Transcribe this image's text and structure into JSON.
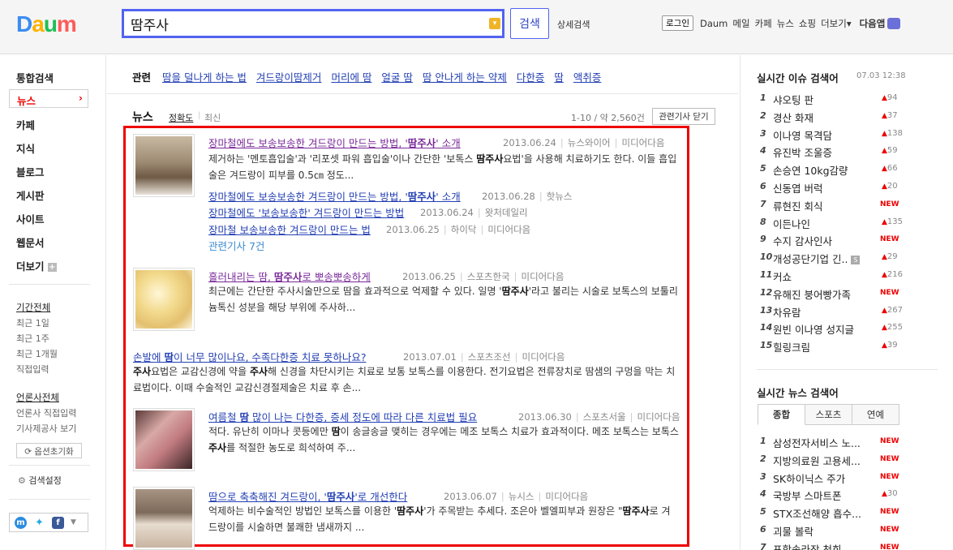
{
  "header": {
    "logo": [
      "D",
      "a",
      "u",
      "m"
    ],
    "logo_colors": [
      "#3c8cf0",
      "#ffb200",
      "#1dbf54",
      "#ff5a5a"
    ],
    "search": {
      "value": "땀주사"
    },
    "search_button": "검색",
    "advanced_search": "상세검색",
    "login": "로그인",
    "links": [
      "Daum",
      "메일",
      "카페",
      "뉴스",
      "쇼핑",
      "더보기▾"
    ],
    "app": "다음앱"
  },
  "left_nav": {
    "items": [
      "통합검색",
      "뉴스",
      "카페",
      "지식",
      "블로그",
      "게시판",
      "사이트",
      "웹문서",
      "더보기"
    ],
    "period_title": "기간전체",
    "periods": [
      "최근 1일",
      "최근 1주",
      "최근 1개월",
      "직접입력"
    ],
    "press_title": "언론사전체",
    "press": [
      "언론사 직접입력",
      "기사제공사 보기"
    ],
    "reset": "옵션초기화",
    "settings": "검색설정"
  },
  "related": {
    "label": "관련",
    "links": [
      "땀을 덜나게 하는 법",
      "겨드랑이땀제거",
      "머리에 땀",
      "얼굴 땀",
      "땀 안나게 하는 약제",
      "다한증",
      "땀",
      "액취증"
    ]
  },
  "news": {
    "heading": "뉴스",
    "sort_accuracy": "정확도",
    "sort_latest": "최신",
    "count": "1-10 / 약 2,560건",
    "close_related": "관련기사 닫기",
    "results": [
      {
        "title_pre": "장마철에도 보송보송한 겨드랑이 만드는 방법, '",
        "title_key": "땀주사",
        "title_post": "' 소개",
        "date": "2013.06.24",
        "source": "뉴스와이어",
        "via": "미디어다음",
        "desc_1": "제거하는 '멘토흡입술'과 '리포셋 파워 흡입술'이나 간단한 '보톡스 ",
        "desc_key": "땀주사",
        "desc_2": "요법'을 사용해 치료하기도 한다. 이들 흡입술은 겨드랑이 피부를 0.5㎝ 정도..."
      },
      {
        "title_pre": "흘러내리는 땀, ",
        "title_key": "땀주사",
        "title_post": "로 뽀송뽀송하게",
        "date": "2013.06.25",
        "source": "스포츠한국",
        "via": "미디어다음",
        "desc_1": "최근에는 간단한 주사시술만으로 땀을 효과적으로 억제할 수 있다. 일명 '",
        "desc_key": "땀주사",
        "desc_2": "'라고 불리는 시술로 보톡스의 보툴리늄톡신 성분을 해당 부위에 주사하..."
      },
      {
        "title_pre": "손발에 ",
        "title_key": "땀",
        "title_post": "이 너무 많이나요, 수족다한증 치료 못하나요?",
        "date": "2013.07.01",
        "source": "스포츠조선",
        "via": "미디어다음",
        "desc_key0": "주사",
        "desc_1": "요법은 교감신경에 약을 ",
        "desc_key": "주사",
        "desc_2": "해 신경을 차단시키는 치료로 보통 보톡스를 이용한다. 전기요법은 전류장치로 땀샘의 구멍을 막는 치료법이다.   이때 수술적인 교감신경절제술은 치료 후 손..."
      },
      {
        "title_pre": "여름철 ",
        "title_key": "땀",
        "title_post": " 많이 나는 다한증, 증세 정도에 따라 다른 치료법 필요",
        "date": "2013.06.30",
        "source": "스포츠서울",
        "via": "미디어다음",
        "desc_1": "적다. 유난히 이마나 콧등에만 ",
        "desc_key": "땀",
        "desc_2": "이 송글송글 맺히는 경우에는 메조 보톡스 치료가 효과적이다. 메조 보톡스는 보톡스 ",
        "desc_key2": "주사",
        "desc_3": "를 적절한 농도로 희석하여 주..."
      },
      {
        "title_pre": "땀으로 축축해진 겨드랑이, '",
        "title_key": "땀주사",
        "title_post": "'로 개선한다",
        "date": "2013.06.07",
        "source": "뉴시스",
        "via": "미디어다음",
        "desc_1": "억제하는 비수술적인 방법인 보톡스를 이용한 '",
        "desc_key": "땀주사",
        "desc_2": "'가 주목받는 추세다. 조은아 벨엘피부과 원장은 \"",
        "desc_key2": "땀주사",
        "desc_3": "로 겨드랑이를 시술하면 불쾌한 냄새까지 ..."
      }
    ],
    "sub_articles": [
      {
        "title_pre": "장마철에도 보송보송한 겨드랑이 만드는 방법, '",
        "title_key": "땀주사",
        "title_post": "' 소개",
        "date": "2013.06.28",
        "source": "핫뉴스"
      },
      {
        "title_pre": "장마철에도 '보송보송한' 겨드랑이 만드는 방법",
        "title_key": "",
        "title_post": "",
        "date": "2013.06.24",
        "source": "왓처데일리"
      },
      {
        "title_pre": "장마철 보송보송한 겨드랑이 만드는 법",
        "title_key": "",
        "title_post": "",
        "date": "2013.06.25",
        "source": "하이닥",
        "via": "미디어다음"
      }
    ],
    "related_more": "관련기사 7건"
  },
  "right_panel": {
    "issue_title": "실시간 이슈 검색어",
    "issue_time": "07.03  12:38",
    "issues": [
      {
        "rank": "1",
        "text": "샤오팅 판",
        "change": "94"
      },
      {
        "rank": "2",
        "text": "경산 화재",
        "change": "37"
      },
      {
        "rank": "3",
        "text": "이나영 목격담",
        "change": "138"
      },
      {
        "rank": "4",
        "text": "유진박 조울증",
        "change": "59"
      },
      {
        "rank": "5",
        "text": "손승연 10kg감량",
        "change": "66"
      },
      {
        "rank": "6",
        "text": "신동엽 버럭",
        "change": "20"
      },
      {
        "rank": "7",
        "text": "류현진 회식",
        "change": "NEW"
      },
      {
        "rank": "8",
        "text": "이든나인",
        "change": "135"
      },
      {
        "rank": "9",
        "text": "수지 감사인사",
        "change": "NEW"
      },
      {
        "rank": "10",
        "text": "개성공단기업 긴..",
        "change": "29",
        "badge": "S"
      },
      {
        "rank": "11",
        "text": "커쇼",
        "change": "216"
      },
      {
        "rank": "12",
        "text": "유해진 붕어빵가족",
        "change": "NEW"
      },
      {
        "rank": "13",
        "text": "차유람",
        "change": "267"
      },
      {
        "rank": "14",
        "text": "원빈 이나영 성지글",
        "change": "255"
      },
      {
        "rank": "15",
        "text": "힐링크림",
        "change": "39"
      }
    ],
    "news_title": "실시간 뉴스 검색어",
    "news_tabs": [
      "종합",
      "스포츠",
      "연예"
    ],
    "news_items": [
      {
        "rank": "1",
        "text": "삼성전자서비스 노...",
        "change": "NEW"
      },
      {
        "rank": "2",
        "text": "지방의료원 고용세...",
        "change": "NEW"
      },
      {
        "rank": "3",
        "text": "SK하이닉스 주가",
        "change": "NEW"
      },
      {
        "rank": "4",
        "text": "국방부 스마트폰",
        "change": "30"
      },
      {
        "rank": "5",
        "text": "STX조선해양 흡수...",
        "change": "NEW"
      },
      {
        "rank": "6",
        "text": "괴물 볼락",
        "change": "NEW"
      },
      {
        "rank": "7",
        "text": "포항송라장 천희",
        "change": "NEW"
      }
    ]
  }
}
